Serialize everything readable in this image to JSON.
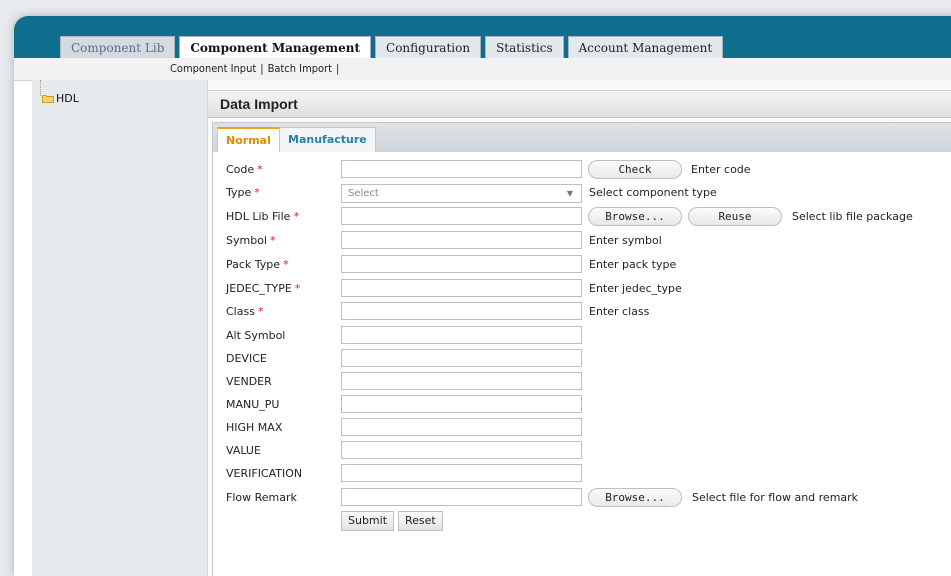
{
  "top_tabs": [
    {
      "label": "Component Lib"
    },
    {
      "label": "Component Management"
    },
    {
      "label": "Configuration"
    },
    {
      "label": "Statistics"
    },
    {
      "label": "Account Management"
    }
  ],
  "subnav": {
    "items": [
      {
        "label": "Component Input"
      },
      {
        "label": "Batch Import"
      }
    ]
  },
  "sidebar": {
    "tree_root": {
      "label": "HDL",
      "icon": "folder-icon"
    }
  },
  "main": {
    "title": "Data Import",
    "tabs": [
      {
        "label": "Normal"
      },
      {
        "label": "Manufacture"
      }
    ],
    "fields": [
      {
        "label": "Code",
        "hint": "Enter code",
        "button": "Check"
      },
      {
        "label": "Type",
        "select_placeholder": "Select",
        "hint": "Select component type"
      },
      {
        "label": "HDL Lib File",
        "button": "Browse...",
        "button2": "Reuse",
        "hint": "Select lib file package"
      },
      {
        "label": "Symbol",
        "hint": "Enter symbol"
      },
      {
        "label": "Pack Type",
        "hint": "Enter pack type"
      },
      {
        "label": "JEDEC_TYPE",
        "hint": "Enter jedec_type"
      },
      {
        "label": "Class",
        "hint": "Enter class"
      },
      {
        "label": "Alt Symbol"
      },
      {
        "label": "DEVICE"
      },
      {
        "label": "VENDER"
      },
      {
        "label": "MANU_PU"
      },
      {
        "label": "HIGH MAX"
      },
      {
        "label": "VALUE"
      },
      {
        "label": "VERIFICATION"
      },
      {
        "label": "Flow Remark",
        "button": "Browse...",
        "hint": "Select file for flow and remark"
      }
    ],
    "required_marker": "*",
    "submit_label": "Submit",
    "reset_label": "Reset"
  },
  "colors": {
    "topbar": "#0d6e8e",
    "required": "#e02020",
    "active_tab": "#e38a00",
    "inactive_tab": "#2a7fb0"
  }
}
